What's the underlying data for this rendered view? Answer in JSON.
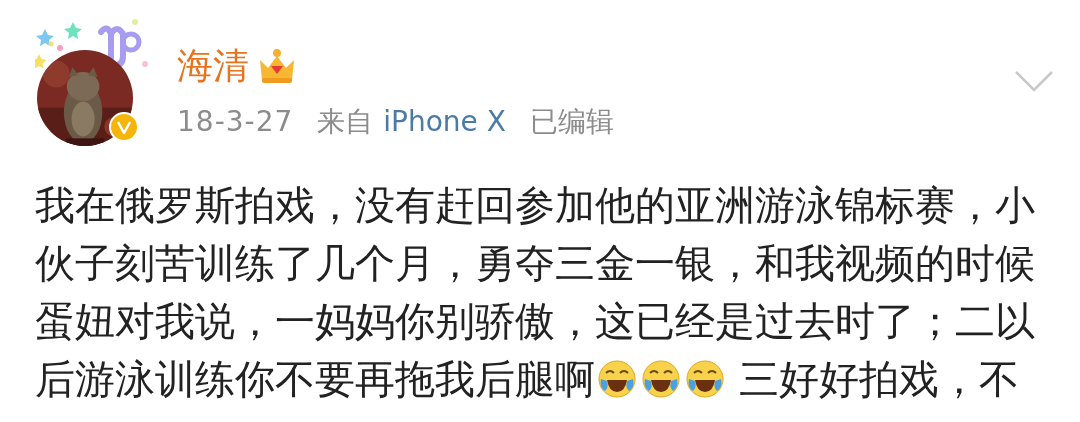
{
  "post": {
    "author": {
      "name": "海清",
      "verified": true,
      "crowned": true
    },
    "meta": {
      "date": "18-3-27",
      "source_prefix": "来自",
      "source": "iPhone X",
      "edited_label": "已编辑"
    },
    "lines": [
      [
        {
          "kind": "text",
          "text": "我在俄罗斯拍戏，没有赶回参加他的亚洲游泳锦标赛，小"
        }
      ],
      [
        {
          "kind": "text",
          "text": "伙子刻苦训练了几个月，勇夺三金一银，和我视频的时候"
        }
      ],
      [
        {
          "kind": "text",
          "text": "蛋妞对我说，一妈妈你别骄傲，这已经是过去时了；二以"
        }
      ],
      [
        {
          "kind": "text",
          "text": "后游泳训练你不要再拖我后腿啊"
        },
        {
          "kind": "emoji"
        },
        {
          "kind": "emoji"
        },
        {
          "kind": "emoji"
        },
        {
          "kind": "text",
          "text": "三好好拍戏，不"
        }
      ]
    ]
  }
}
